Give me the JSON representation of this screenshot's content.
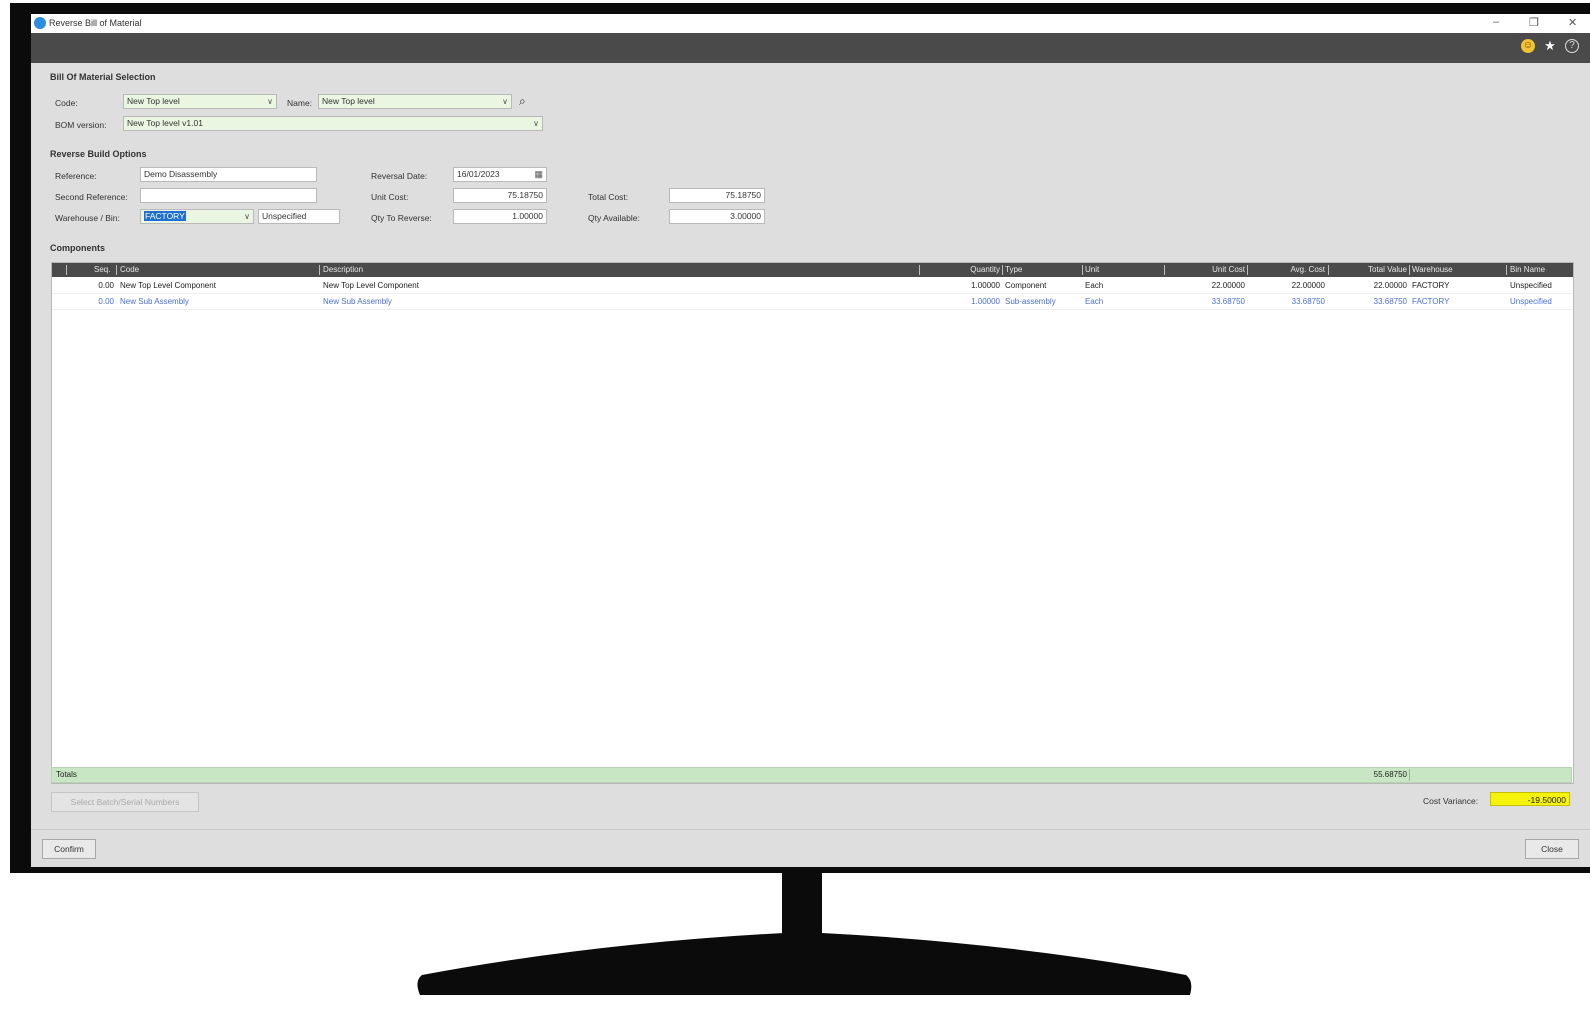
{
  "window": {
    "title": "Reverse Bill of Material"
  },
  "colors": {
    "toolbar": "#4a4a4a",
    "grid_header": "#4a4a4a",
    "totals_row": "#c9e6c4",
    "cost_variance": "#f5f20b",
    "link_blue": "#4a6fd8"
  },
  "toolbar_icons": [
    "smiley-icon",
    "star-icon",
    "help-icon"
  ],
  "bom_selection": {
    "section_title": "Bill Of Material Selection",
    "code_label": "Code:",
    "code_value": "New Top level",
    "name_label": "Name:",
    "name_value": "New Top level",
    "bom_version_label": "BOM version:",
    "bom_version_value": "New Top level v1.01"
  },
  "reverse_build": {
    "section_title": "Reverse Build Options",
    "reference_label": "Reference:",
    "reference_value": "Demo Disassembly",
    "second_reference_label": "Second Reference:",
    "second_reference_value": "",
    "warehouse_label": "Warehouse / Bin:",
    "warehouse_value": "FACTORY",
    "bin_value": "Unspecified",
    "reversal_date_label": "Reversal Date:",
    "reversal_date_value": "16/01/2023",
    "unit_cost_label": "Unit Cost:",
    "unit_cost_value": "75.18750",
    "qty_to_reverse_label": "Qty To Reverse:",
    "qty_to_reverse_value": "1.00000",
    "total_cost_label": "Total Cost:",
    "total_cost_value": "75.18750",
    "qty_available_label": "Qty Available:",
    "qty_available_value": "3.00000"
  },
  "components": {
    "section_title": "Components",
    "columns": [
      "Seq.",
      "Code",
      "Description",
      "Quantity",
      "Type",
      "Unit",
      "Unit Cost",
      "Avg. Cost",
      "Total Value",
      "Warehouse",
      "Bin Name"
    ],
    "rows": [
      {
        "seq": "0.00",
        "code": "New Top Level Component",
        "description": "New Top Level Component",
        "quantity": "1.00000",
        "type": "Component",
        "unit": "Each",
        "unit_cost": "22.00000",
        "avg_cost": "22.00000",
        "total_value": "22.00000",
        "warehouse": "FACTORY",
        "bin": "Unspecified"
      },
      {
        "seq": "0.00",
        "code": "New Sub Assembly",
        "description": "New Sub Assembly",
        "quantity": "1.00000",
        "type": "Sub-assembly",
        "unit": "Each",
        "unit_cost": "33.68750",
        "avg_cost": "33.68750",
        "total_value": "33.68750",
        "warehouse": "FACTORY",
        "bin": "Unspecified"
      }
    ],
    "totals_label": "Totals",
    "totals_value": "55.68750"
  },
  "select_batch_button": "Select Batch/Serial Numbers",
  "cost_variance_label": "Cost Variance:",
  "cost_variance_value": "-19.50000",
  "confirm_button": "Confirm",
  "close_button": "Close"
}
